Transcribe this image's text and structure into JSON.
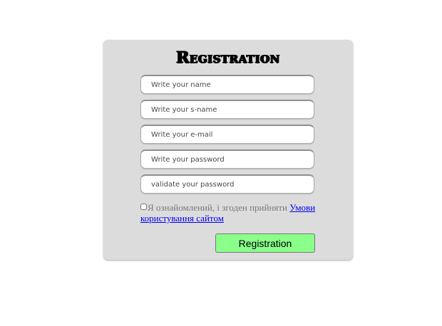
{
  "form": {
    "title": "Registration",
    "fields": [
      {
        "placeholder": "Write your name"
      },
      {
        "placeholder": "Write your s-name"
      },
      {
        "placeholder": "Write your e-mail"
      },
      {
        "placeholder": "Write your password"
      },
      {
        "placeholder": "validate your password"
      }
    ],
    "terms": {
      "checked": false,
      "text": "Я ознайомлений, і згоден прийняти ",
      "link_text": "Умови користування сайтом"
    },
    "submit_label": "Registration",
    "submit_color": "#8aff8a"
  }
}
